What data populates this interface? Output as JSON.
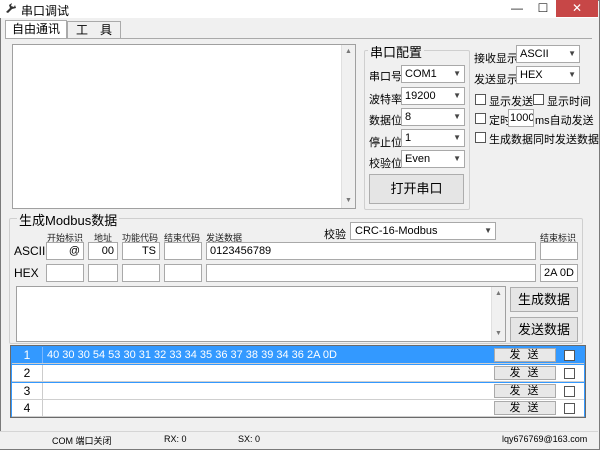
{
  "window": {
    "title": "串口调试",
    "min": "—",
    "max": "☐",
    "close": "✕"
  },
  "tabs": [
    {
      "label": "自由通讯"
    },
    {
      "label": "工　具"
    }
  ],
  "serial_config": {
    "title": "串口配置",
    "port_label": "串口号",
    "port_value": "COM1",
    "baud_label": "波特率",
    "baud_value": "19200",
    "data_bits_label": "数据位",
    "data_bits_value": "8",
    "stop_bits_label": "停止位",
    "stop_bits_value": "1",
    "parity_label": "校验位",
    "parity_value": "Even",
    "open_button": "打开串口"
  },
  "display": {
    "recv_label": "接收显示",
    "recv_value": "ASCII",
    "send_label": "发送显示",
    "send_value": "HEX",
    "show_send": "显示发送",
    "show_time": "显示时间",
    "timer_prefix": "定时",
    "timer_value": "1000",
    "timer_suffix": "ms自动发送",
    "gen_send": "生成数据同时发送数据"
  },
  "modbus": {
    "title": "生成Modbus数据",
    "col_start": "开始标识",
    "col_addr": "地址",
    "col_func": "功能代码",
    "col_end_code": "结束代码",
    "col_send_data": "发送数据",
    "check_label": "校验",
    "check_value": "CRC-16-Modbus",
    "end_mark_label": "结束标识",
    "ascii_label": "ASCII",
    "hex_label": "HEX",
    "ascii_start": "@",
    "ascii_addr": "00",
    "ascii_func": "TS",
    "ascii_end_code": "",
    "ascii_data": "0123456789",
    "ascii_end_mark": "",
    "hex_end_mark": "2A 0D",
    "gen_button": "生成数据",
    "send_button": "发送数据"
  },
  "send_list": [
    {
      "num": "1",
      "data": "40 30 30 54 53 30 31 32 33 34 35 36 37 38 39 34 36 2A 0D",
      "btn": "发 送"
    },
    {
      "num": "2",
      "data": "",
      "btn": "发 送"
    },
    {
      "num": "3",
      "data": "",
      "btn": "发 送"
    },
    {
      "num": "4",
      "data": "",
      "btn": "发 送"
    }
  ],
  "status": {
    "port": "COM 端口关闭",
    "rx": "RX: 0",
    "sx": "SX: 0",
    "email": "lqy676769@163.com"
  }
}
